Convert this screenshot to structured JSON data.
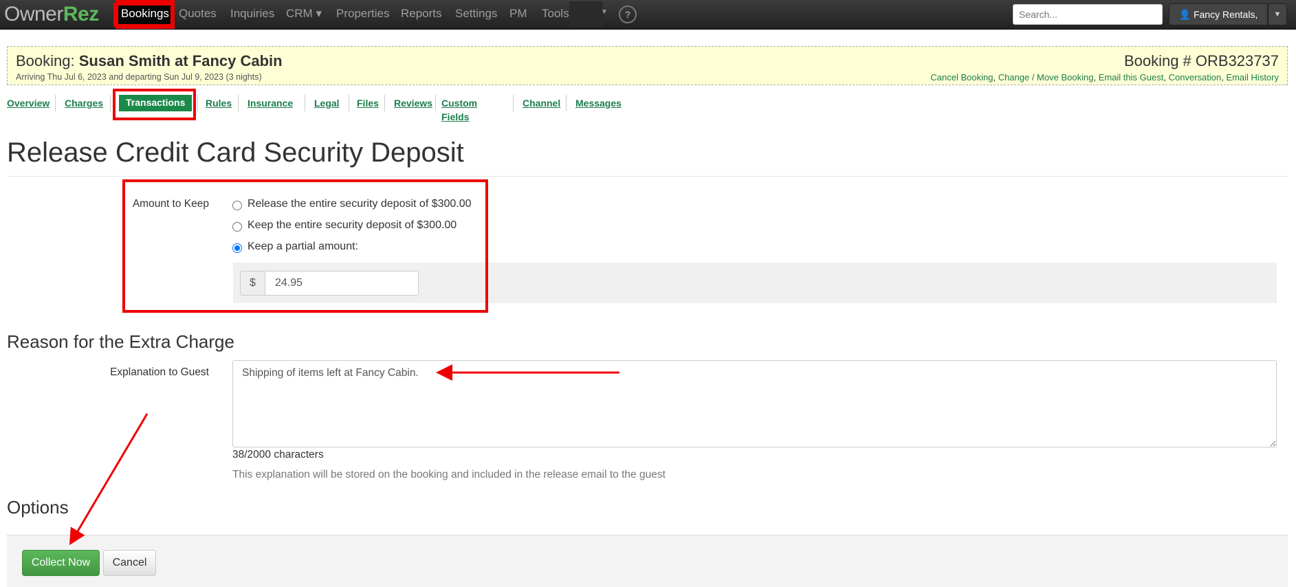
{
  "nav": {
    "logo": {
      "part1": "Owner",
      "part2": "Rez"
    },
    "items": [
      "Bookings",
      "Quotes",
      "Inquiries",
      "CRM ▾",
      "Properties",
      "Reports",
      "Settings",
      "PM",
      "Tools"
    ],
    "active": "Bookings",
    "help": "?",
    "search_placeholder": "Search...",
    "user": "Fancy Rentals, LLC"
  },
  "banner": {
    "title_prefix": "Booking:",
    "title": "Susan Smith at Fancy Cabin",
    "subtitle": "Arriving Thu Jul 6, 2023 and departing Sun Jul 9, 2023 (3 nights)",
    "booking_number": "Booking # ORB323737",
    "links": [
      "Cancel Booking",
      "Change / Move Booking",
      "Email this Guest",
      "Conversation",
      "Email History"
    ]
  },
  "tabs": [
    "Overview",
    "Charges",
    "Transactions",
    "Rules",
    "Insurance",
    "Legal",
    "Files",
    "Reviews",
    "Custom Fields",
    "Channel",
    "Messages"
  ],
  "active_tab": "Transactions",
  "page_title": "Release Credit Card Security Deposit",
  "amount": {
    "label": "Amount to Keep",
    "options": [
      "Release the entire security deposit of $300.00",
      "Keep the entire security deposit of $300.00",
      "Keep a partial amount:"
    ],
    "selected_index": 2,
    "currency": "$",
    "value": "24.95"
  },
  "reason": {
    "heading": "Reason for the Extra Charge",
    "label": "Explanation to Guest",
    "value": "Shipping of items left at Fancy Cabin.",
    "count": "38/2000 characters",
    "help": "This explanation will be stored on the booking and included in the release email to the guest"
  },
  "options_heading": "Options",
  "footer": {
    "collect": "Collect Now",
    "cancel": "Cancel"
  },
  "annotation_color": "#ee0000"
}
